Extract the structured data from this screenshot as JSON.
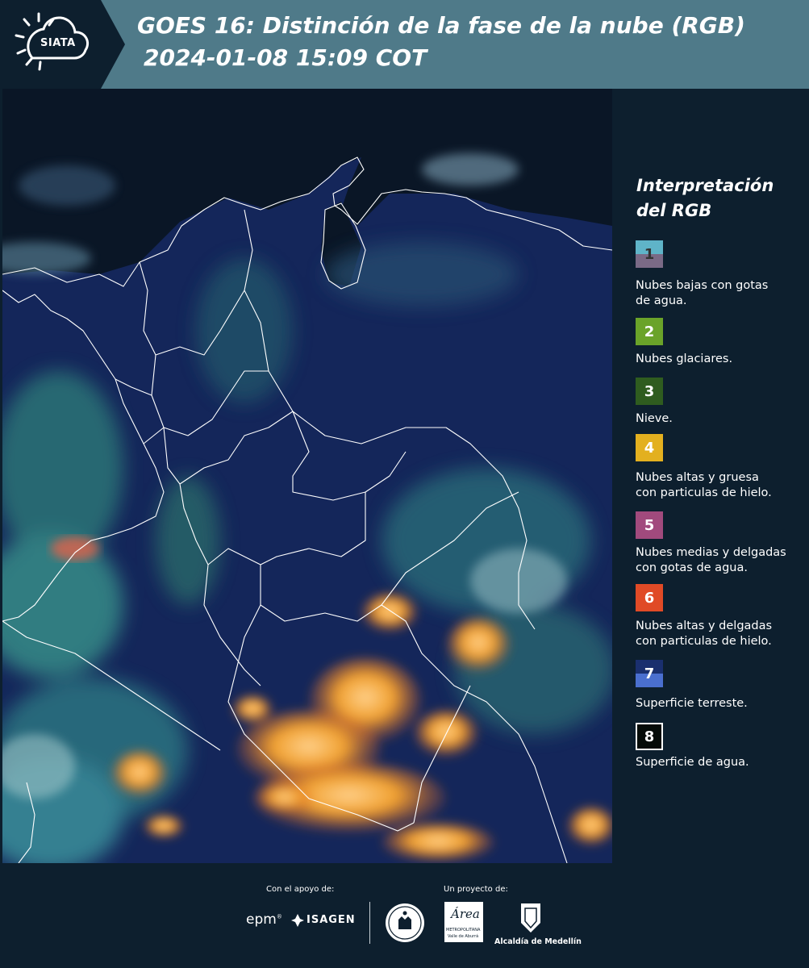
{
  "header": {
    "logo_text": "SIATA",
    "title": "GOES 16: Distinción de la fase de la nube (RGB)",
    "subtitle": "2024-01-08 15:09 COT"
  },
  "legend": {
    "title_line1": "Interpretación",
    "title_line2": "del RGB",
    "items": [
      {
        "number": "1",
        "lines": [
          "Nubes bajas con gotas",
          "de agua."
        ],
        "color_top": "#5fb4c8",
        "color_bottom": "#7a6a86"
      },
      {
        "number": "2",
        "lines": [
          "Nubes glaciares."
        ],
        "color": "#6aa329"
      },
      {
        "number": "3",
        "lines": [
          "Nieve."
        ],
        "color": "#2f5c1f"
      },
      {
        "number": "4",
        "lines": [
          "Nubes altas y gruesa",
          "con particulas de hielo."
        ],
        "color": "#e3b01f"
      },
      {
        "number": "5",
        "lines": [
          "Nubes medias y delgadas",
          "con gotas de agua."
        ],
        "color": "#a14a7d"
      },
      {
        "number": "6",
        "lines": [
          "Nubes altas y delgadas",
          "con particulas de hielo."
        ],
        "color": "#e04a26"
      },
      {
        "number": "7",
        "lines": [
          "Superficie terreste."
        ],
        "color_top": "#1a2f6e",
        "color_bottom": "#4a6fcf"
      },
      {
        "number": "8",
        "lines": [
          "Superficie de agua."
        ],
        "color": "#050b08"
      }
    ]
  },
  "footer": {
    "support_label": "Con el apoyo de:",
    "project_label": "Un proyecto de:",
    "epm": "epm",
    "isagen": "ISAGEN",
    "area_main": "Área",
    "area_sub1": "METROPOLITANA",
    "area_sub2": "Valle de Aburrá",
    "alcaldia": "Alcaldía de Medellín"
  }
}
